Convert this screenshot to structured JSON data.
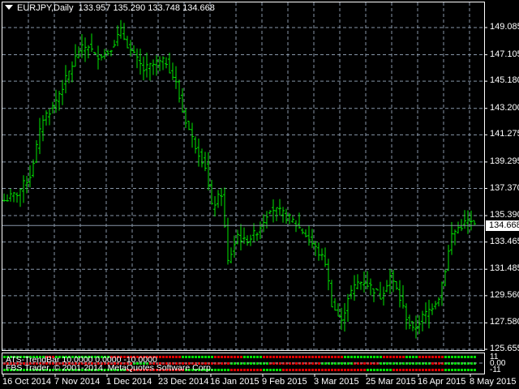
{
  "header": {
    "symbol_timeframe": "EURJPY,Daily",
    "ohlc": "133.957 135.290 133.748 134.668"
  },
  "price_axis": [
    "149.085",
    "147.105",
    "145.180",
    "143.200",
    "141.275",
    "139.295",
    "137.370",
    "135.390",
    "133.465",
    "131.485",
    "129.560",
    "127.580",
    "125.655"
  ],
  "current_price": "134.668",
  "date_axis": [
    "16 Oct 2014",
    "7 Nov 2014",
    "1 Dec 2014",
    "23 Dec 2014",
    "16 Jan 2015",
    "9 Feb 2015",
    "3 Mar 2015",
    "25 Mar 2015",
    "16 Apr 2015",
    "8 May 2015"
  ],
  "indicator": {
    "legend": "ATS-TrendBar 10.0000 0.0000 -10.0000",
    "copyright": "FBS Trader, © 2001-2014, MetaQuotes Software Corp.",
    "scale": [
      "11",
      "0.00",
      "-11"
    ],
    "rows": [
      [
        [
          "G",
          13
        ],
        [
          "R",
          3
        ],
        [
          "G",
          17
        ],
        [
          "R",
          22
        ],
        [
          "G",
          10
        ],
        [
          "R",
          9
        ],
        [
          "G",
          6
        ],
        [
          "R",
          25
        ],
        [
          "G",
          12
        ],
        [
          "R",
          7
        ],
        [
          "G",
          4
        ],
        [
          "R",
          8
        ],
        [
          "G",
          10
        ]
      ],
      [
        [
          "R",
          40
        ],
        [
          "G",
          5
        ],
        [
          "R",
          25
        ],
        [
          "G",
          12
        ],
        [
          "R",
          16
        ],
        [
          "G",
          10
        ],
        [
          "R",
          8
        ],
        [
          "G",
          16
        ],
        [
          "R",
          4
        ],
        [
          "G",
          10
        ]
      ],
      [
        [
          "G",
          38
        ],
        [
          "R",
          18
        ],
        [
          "G",
          14
        ],
        [
          "R",
          10
        ],
        [
          "G",
          6
        ],
        [
          "R",
          26
        ],
        [
          "G",
          8
        ],
        [
          "R",
          16
        ],
        [
          "G",
          10
        ]
      ]
    ]
  },
  "colors": {
    "bar": "#00e600",
    "grid": "#8796a8",
    "bull_dot": "#00e000",
    "bear_dot": "#e00000",
    "current_line": "#8796a8"
  },
  "chart_data": {
    "type": "ohlc",
    "symbol": "EURJPY",
    "timeframe": "Daily",
    "ylim": [
      125.655,
      149.085
    ],
    "close_keypoints": [
      [
        0,
        136.5
      ],
      [
        4,
        137
      ],
      [
        8,
        138.3
      ],
      [
        12,
        142.5
      ],
      [
        15,
        143.3
      ],
      [
        19,
        145.3
      ],
      [
        23,
        147.4
      ],
      [
        26,
        147.8
      ],
      [
        28,
        147
      ],
      [
        32,
        147.3
      ],
      [
        36,
        148.8
      ],
      [
        39,
        147.4
      ],
      [
        43,
        146
      ],
      [
        47,
        146.5
      ],
      [
        50,
        146.6
      ],
      [
        53,
        145
      ],
      [
        55,
        143
      ],
      [
        58,
        141
      ],
      [
        62,
        139
      ],
      [
        64,
        136
      ],
      [
        67,
        137
      ],
      [
        69,
        132
      ],
      [
        72,
        134
      ],
      [
        74,
        133.5
      ],
      [
        77,
        134
      ],
      [
        79,
        134.6
      ],
      [
        82,
        136
      ],
      [
        86,
        135.5
      ],
      [
        89,
        135
      ],
      [
        93,
        134
      ],
      [
        96,
        133
      ],
      [
        99,
        132
      ],
      [
        101,
        129
      ],
      [
        104,
        127.6
      ],
      [
        106,
        129.5
      ],
      [
        109,
        130.5
      ],
      [
        111,
        130.6
      ],
      [
        114,
        130
      ],
      [
        116,
        129.5
      ],
      [
        119,
        131
      ],
      [
        121,
        130
      ],
      [
        124,
        128
      ],
      [
        126,
        127
      ],
      [
        129,
        128
      ],
      [
        131,
        128.5
      ],
      [
        134,
        129.5
      ],
      [
        136,
        131.5
      ],
      [
        138,
        134
      ],
      [
        140,
        134.5
      ],
      [
        143,
        135
      ],
      [
        145,
        134.668
      ]
    ]
  }
}
